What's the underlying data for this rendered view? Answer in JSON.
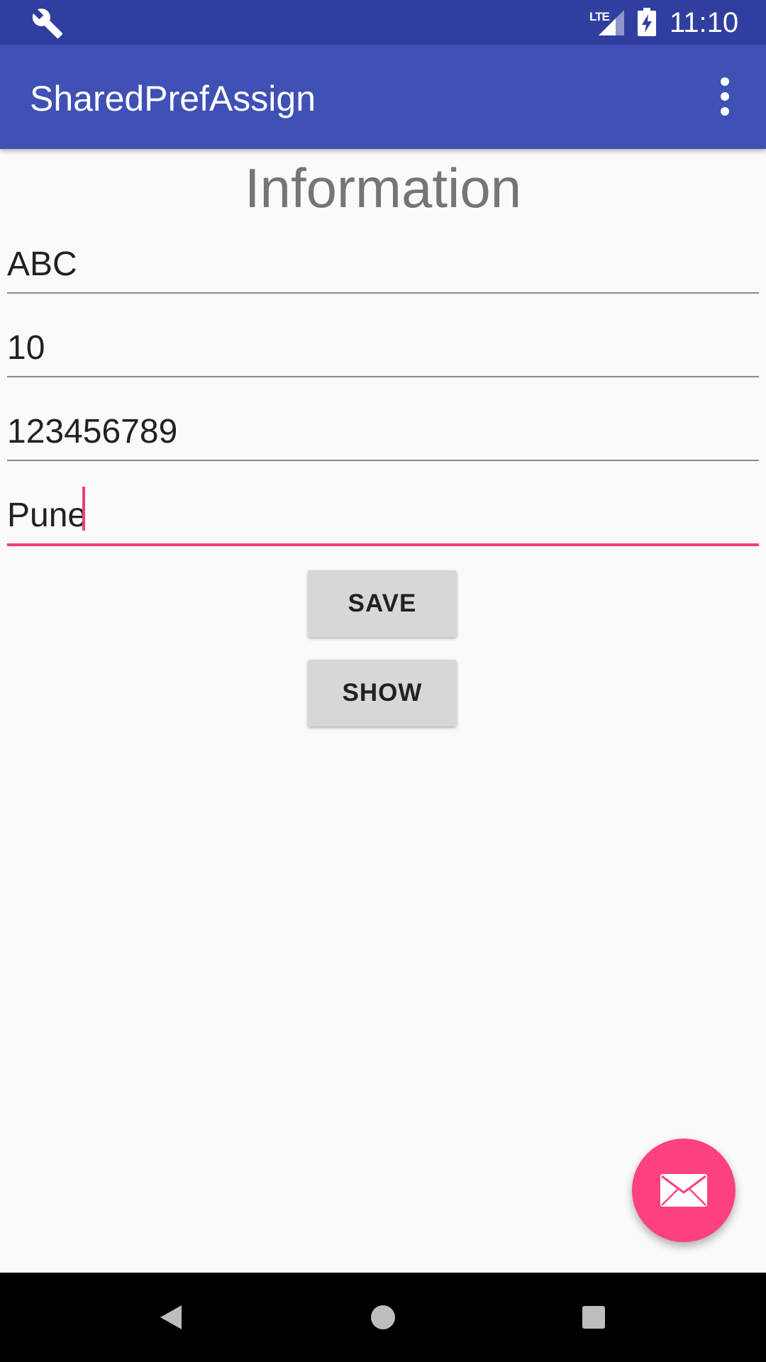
{
  "status_bar": {
    "network": "LTE",
    "time": "11:10",
    "icons": [
      "wrench-icon",
      "signal-icon",
      "battery-charging-icon"
    ]
  },
  "app_bar": {
    "title": "SharedPrefAssign",
    "menu_icon": "more-vert-icon"
  },
  "main": {
    "heading": "Information",
    "fields": [
      {
        "value": "ABC"
      },
      {
        "value": "10"
      },
      {
        "value": "123456789"
      },
      {
        "value": "Pune",
        "focused": true
      }
    ],
    "buttons": {
      "save_label": "SAVE",
      "show_label": "SHOW"
    }
  },
  "fab": {
    "icon": "email-icon"
  },
  "nav_bar": {
    "icons": [
      "back-icon",
      "home-icon",
      "recents-icon"
    ]
  },
  "colors": {
    "primary_dark": "#303f9f",
    "primary": "#3f51b5",
    "accent": "#ff4081",
    "focus_underline": "#ec407a"
  }
}
